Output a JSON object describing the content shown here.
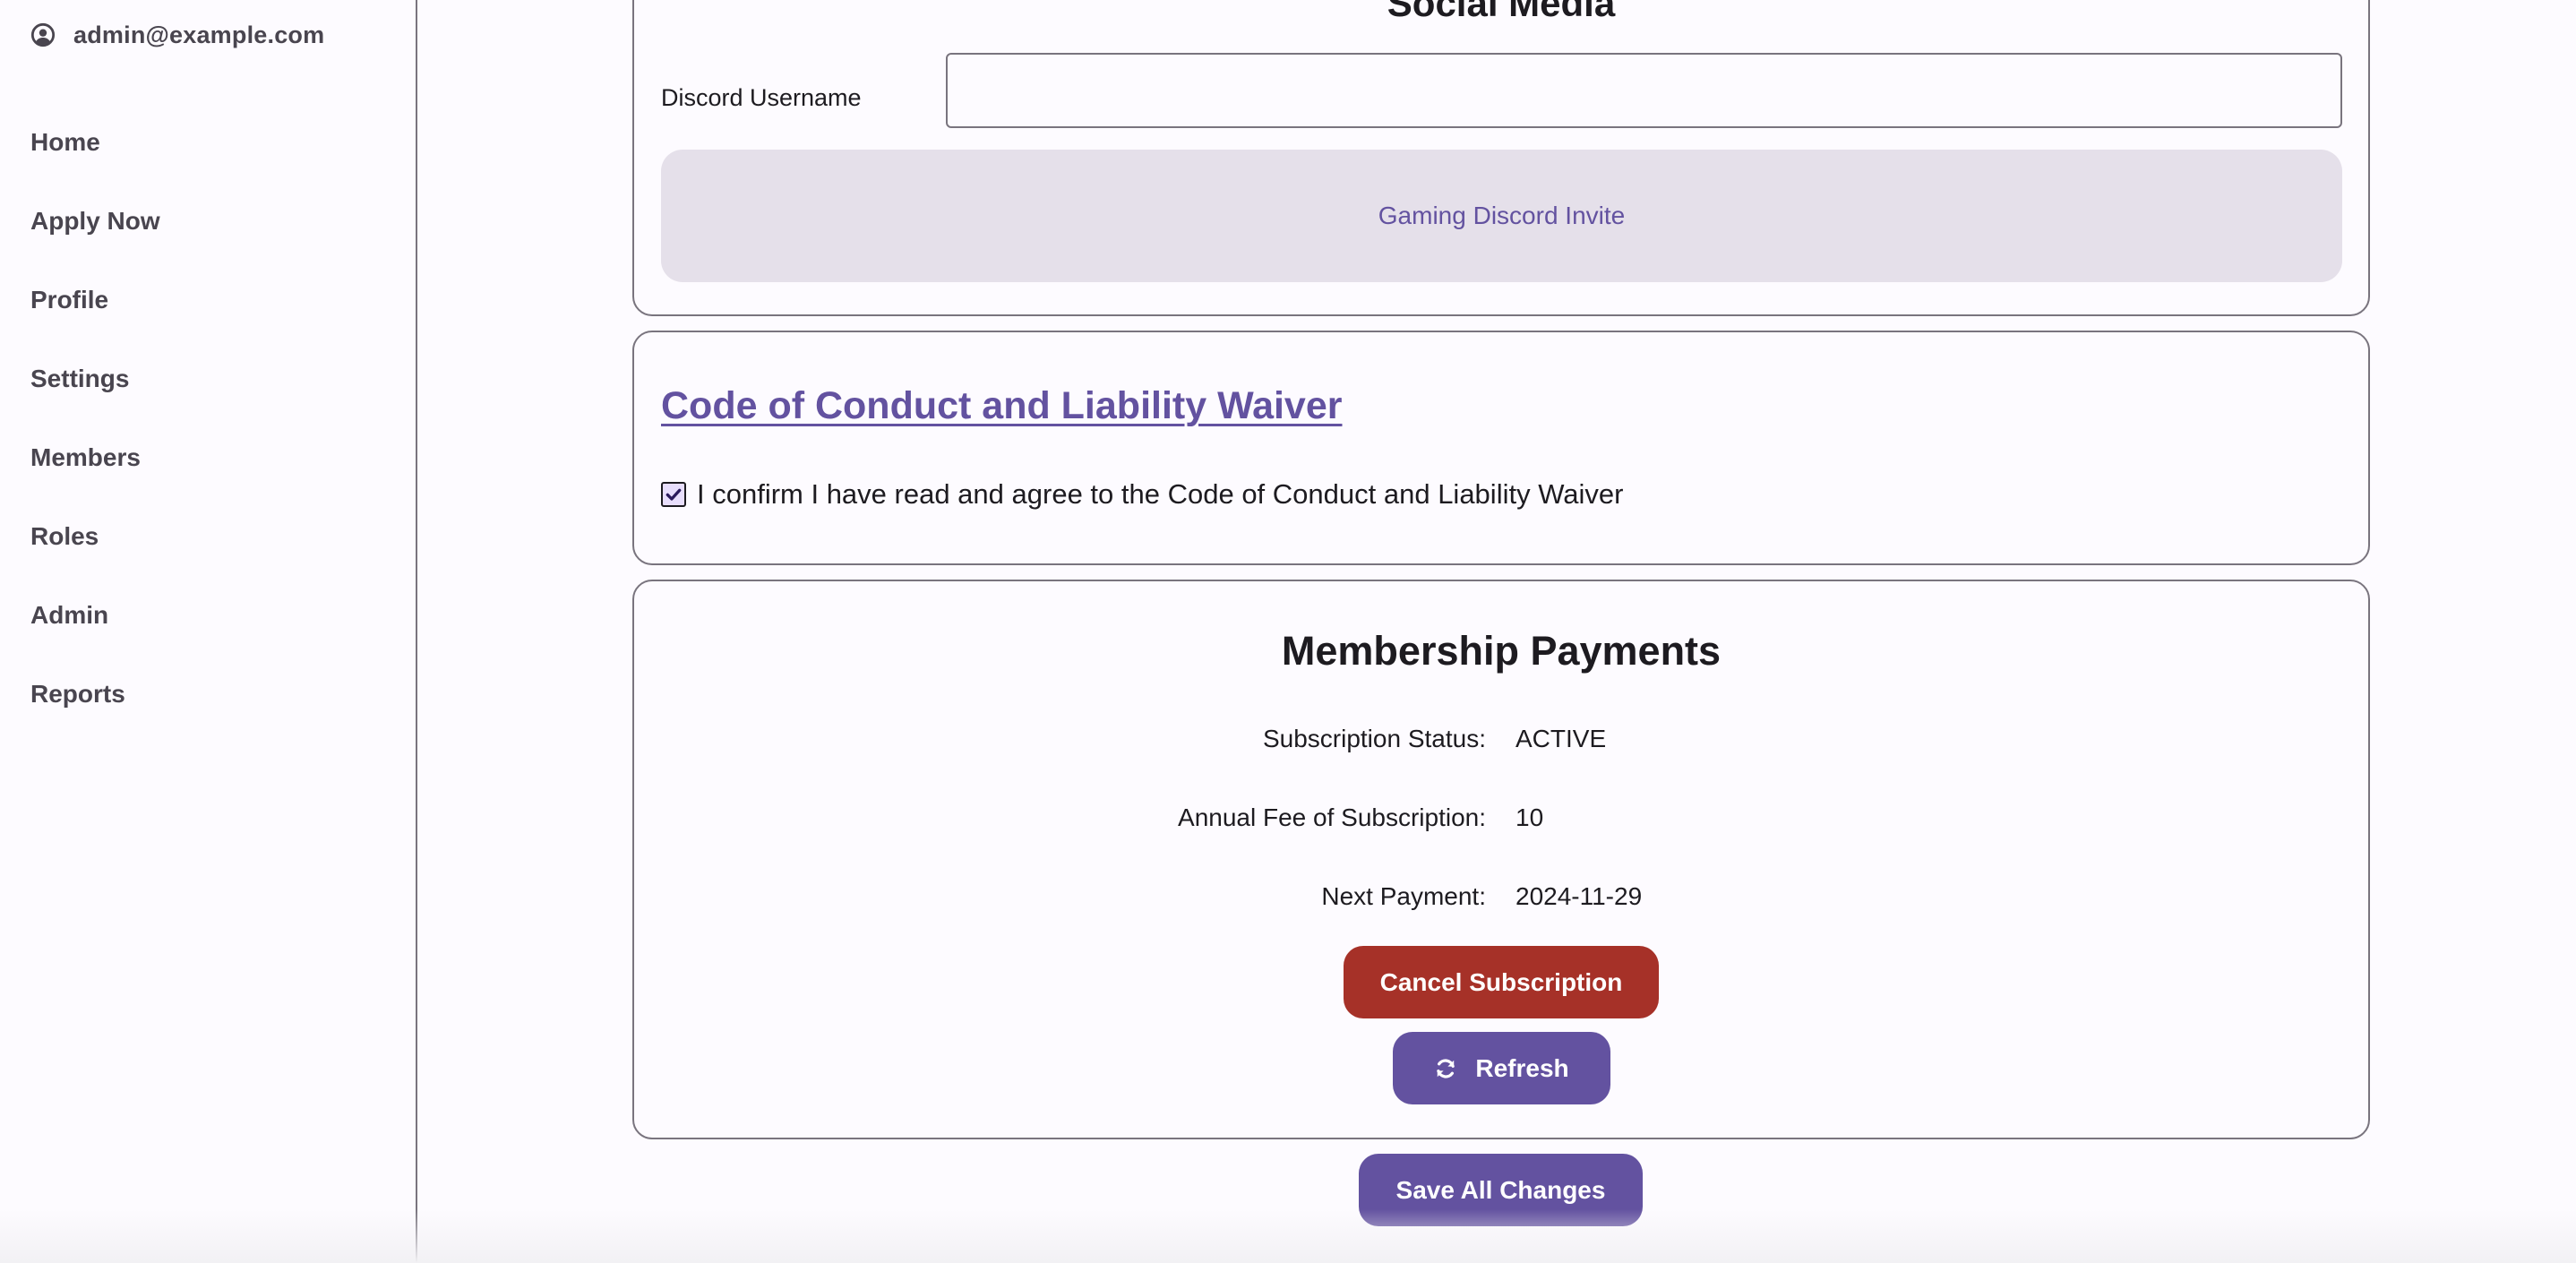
{
  "user": {
    "email": "admin@example.com",
    "icon": "account-circle-icon"
  },
  "sidebar": {
    "items": [
      {
        "label": "Home"
      },
      {
        "label": "Apply Now"
      },
      {
        "label": "Profile"
      },
      {
        "label": "Settings"
      },
      {
        "label": "Members"
      },
      {
        "label": "Roles"
      },
      {
        "label": "Admin"
      },
      {
        "label": "Reports"
      }
    ]
  },
  "social": {
    "title": "Social Media",
    "discord_label": "Discord Username",
    "discord_value": "",
    "discord_placeholder": "",
    "invite_label": "Gaming Discord Invite"
  },
  "code_of_conduct": {
    "link_label": "Code of Conduct and Liability Waiver",
    "checkbox_checked": true,
    "checkbox_label": "I confirm I have read and agree to the Code of Conduct and Liability Waiver"
  },
  "payments": {
    "title": "Membership Payments",
    "rows": [
      {
        "label": "Subscription Status:",
        "value": "ACTIVE"
      },
      {
        "label": "Annual Fee of Subscription:",
        "value": "10"
      },
      {
        "label": "Next Payment:",
        "value": "2024-11-29"
      }
    ],
    "cancel_label": "Cancel Subscription",
    "refresh_label": "Refresh",
    "refresh_icon": "refresh-icon"
  },
  "footer": {
    "save_label": "Save All Changes"
  },
  "colors": {
    "primary": "#6352a0",
    "danger": "#a63128",
    "outline": "#79747e",
    "surface": "#fdfbff",
    "tonal": "#e5e0ea"
  }
}
